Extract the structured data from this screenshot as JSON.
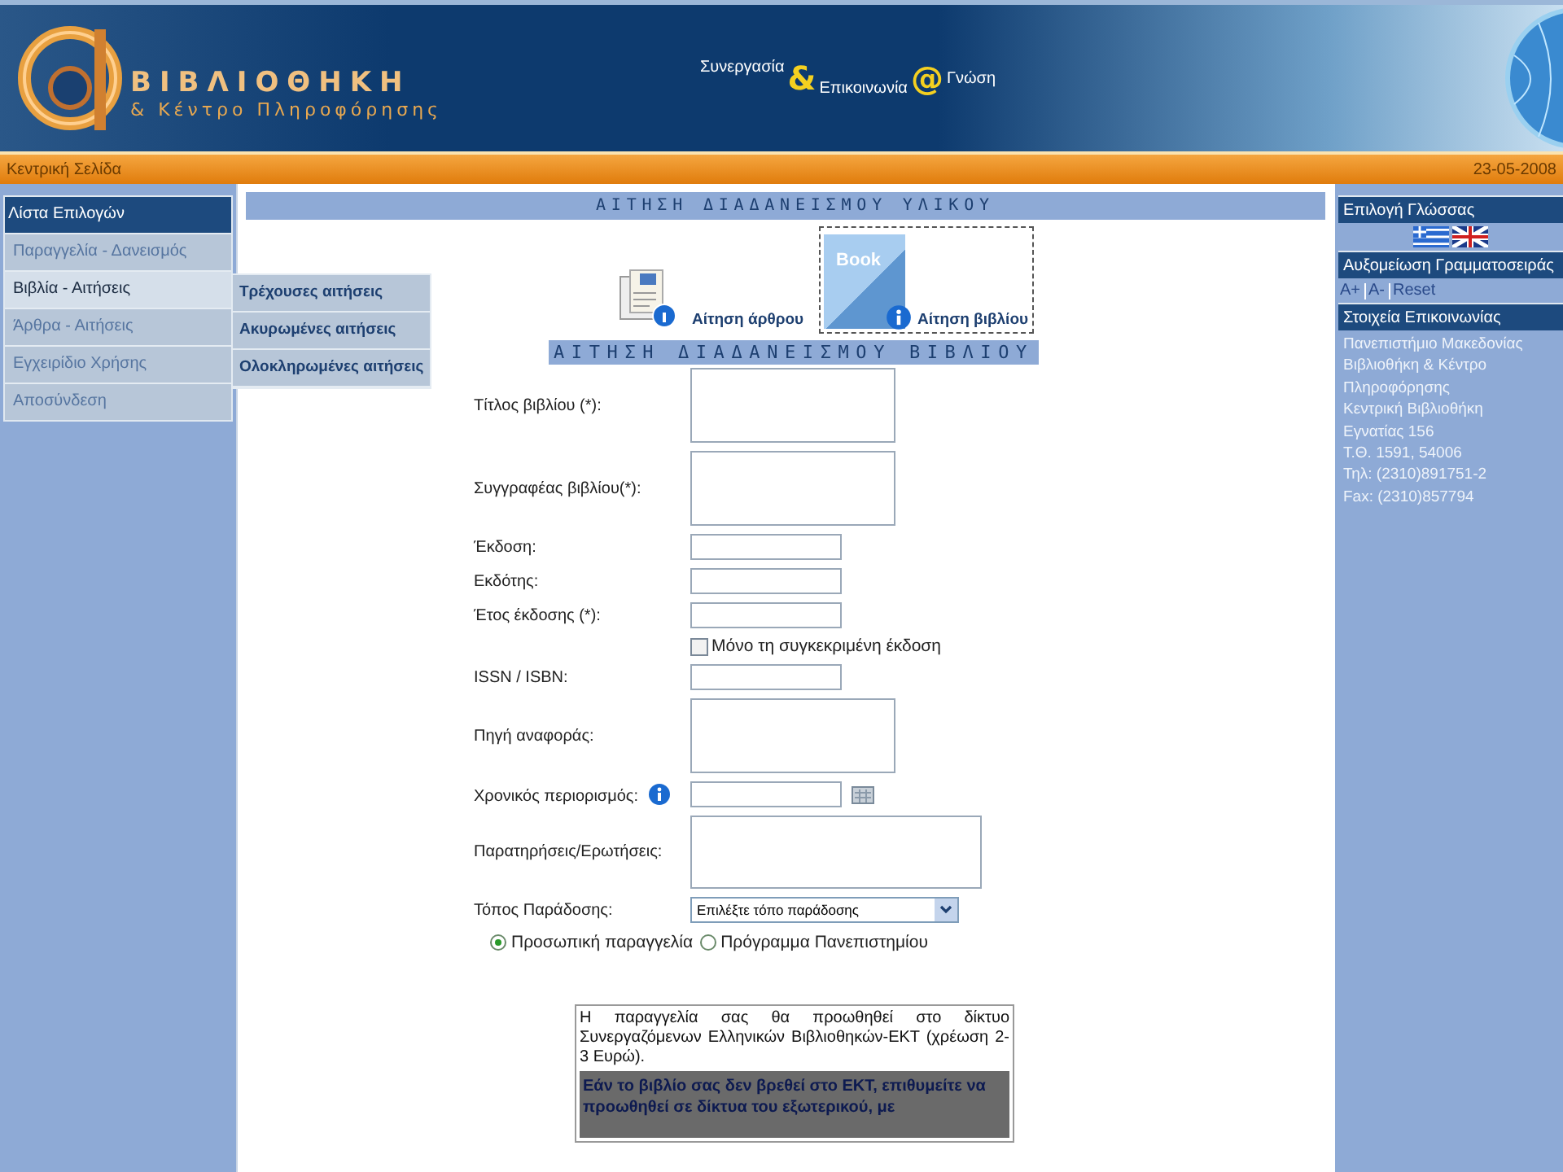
{
  "header": {
    "title": "ΒΙΒΛΙΟΘΗΚΗ",
    "subtitle": "& Κέντρο Πληροφόρησης",
    "slogan": [
      "Συνεργασία",
      "&",
      "Επικοινωνία",
      "@",
      "Γνώση"
    ]
  },
  "nav_bar": {
    "home_link": "Κεντρική Σελίδα",
    "date": "23-05-2008"
  },
  "left_menu": {
    "title": "Λίστα Επιλογών",
    "items": [
      {
        "label": "Παραγγελία - Δανεισμός",
        "selected": false
      },
      {
        "label": "Βιβλία - Αιτήσεις",
        "selected": true
      },
      {
        "label": "Άρθρα - Αιτήσεις",
        "selected": false
      },
      {
        "label": "Εγχειρίδιο Χρήσης",
        "selected": false
      },
      {
        "label": "Αποσύνδεση",
        "selected": false
      }
    ],
    "submenu": [
      "Τρέχουσες αιτήσεις",
      "Ακυρωμένες αιτήσεις",
      "Ολοκληρωμένες αιτήσεις"
    ]
  },
  "main": {
    "title": "ΑΙΤΗΣΗ ΔΙΑΔΑΝΕΙΣΜΟΥ ΥΛΙΚΟΥ",
    "request_types": [
      {
        "kind": "article",
        "label": "Αίτηση άρθρου",
        "selected": false
      },
      {
        "kind": "book",
        "label": "Αίτηση βιβλίου",
        "icon_text": "Book",
        "selected": true
      }
    ],
    "form_title": "ΑΙΤΗΣΗ ΔΙΑΔΑΝΕΙΣΜΟΥ ΒΙΒΛΙΟΥ",
    "fields": [
      {
        "kind": "textarea",
        "label": "Τίτλος βιβλίου (*):"
      },
      {
        "kind": "textarea",
        "label": "Συγγραφέας βιβλίου(*):"
      },
      {
        "kind": "input",
        "label": "Έκδοση:"
      },
      {
        "kind": "input",
        "label": "Εκδότης:"
      },
      {
        "kind": "input",
        "label": "Έτος έκδοσης (*):"
      },
      {
        "kind": "checkbox",
        "label": "Μόνο τη συγκεκριμένη έκδοση",
        "checked": false
      },
      {
        "kind": "input",
        "label": "ISSN / ISBN:"
      },
      {
        "kind": "textarea",
        "label": "Πηγή αναφοράς:"
      },
      {
        "kind": "date",
        "label": "Χρονικός περιορισμός:"
      },
      {
        "kind": "wide_textarea",
        "label": "Παρατηρήσεις/Ερωτήσεις:"
      },
      {
        "kind": "select",
        "label": "Τόπος Παράδοσης:",
        "value": "Επιλέξτε τόπο παράδοσης"
      }
    ],
    "order_types": [
      {
        "label": "Προσωπική παραγγελία",
        "selected": true
      },
      {
        "label": "Πρόγραμμα Πανεπιστημίου",
        "selected": false
      }
    ],
    "notice": "Η παραγγελία σας θα προωθηθεί στο δίκτυο Συνεργαζόμενων Ελληνικών Βιβλιοθηκών-ΕΚΤ (χρέωση 2-3 Ευρώ).",
    "question": "Εάν το βιβλίο σας δεν βρεθεί στο ΕΚΤ, επιθυμείτε να προωθηθεί σε δίκτυα του εξωτερικού, με"
  },
  "right_panel": {
    "language_title": "Επιλογή Γλώσσας",
    "font_title": "Αυξομείωση Γραμματοσειράς",
    "font_links": [
      "A+",
      "A-",
      "Reset"
    ],
    "contact_title": "Στοιχεία Επικοινωνίας",
    "contact_lines": [
      "Πανεπιστήμιο Μακεδονίας",
      "Βιβλιοθήκη & Κέντρο",
      "Πληροφόρησης",
      "Κεντρική Βιβλιοθήκη",
      "Εγνατίας 156",
      "Τ.Θ. 1591, 54006",
      "Τηλ: (2310)891751-2",
      "Fax: (2310)857794"
    ]
  }
}
